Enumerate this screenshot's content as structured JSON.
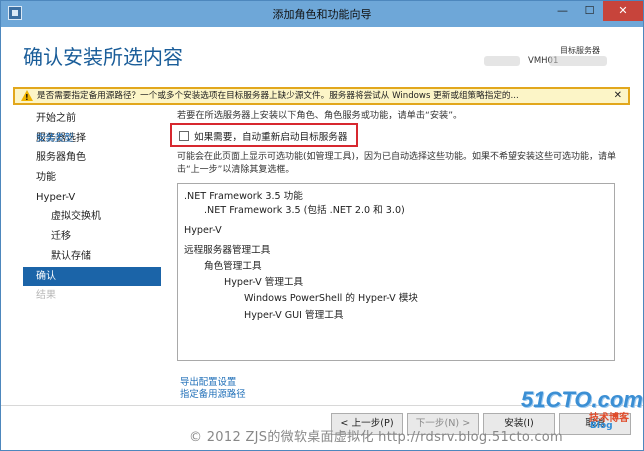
{
  "window": {
    "title": "添加角色和功能向导",
    "minimize": "—",
    "maximize": "☐",
    "close": "✕"
  },
  "header": {
    "page_title": "确认安装所选内容",
    "target_label": "目标服务器",
    "target_value": "VMH01"
  },
  "warning": {
    "icon": "warning-icon",
    "text": "是否需要指定备用源路径？一个或多个安装选项在目标服务器上缺少源文件。服务器将尝试从 Windows 更新或组策略指定的...",
    "close": "✕"
  },
  "sidebar": {
    "items": [
      {
        "label": "开始之前",
        "state": "normal"
      },
      {
        "label": "安装类型",
        "state": "link"
      },
      {
        "label": "服务器选择",
        "state": "normal"
      },
      {
        "label": "服务器角色",
        "state": "normal"
      },
      {
        "label": "功能",
        "state": "normal"
      },
      {
        "label": "Hyper-V",
        "state": "normal"
      },
      {
        "label": "虚拟交换机",
        "state": "normal"
      },
      {
        "label": "迁移",
        "state": "normal"
      },
      {
        "label": "默认存储",
        "state": "normal"
      },
      {
        "label": "确认",
        "state": "active"
      },
      {
        "label": "结果",
        "state": "disabled"
      }
    ]
  },
  "content": {
    "intro": "若要在所选服务器上安装以下角色、角色服务或功能，请单击“安装”。",
    "restart_checkbox": {
      "label": "如果需要，自动重新启动目标服务器",
      "checked": false
    },
    "note": "可能会在此页面上显示可选功能(如管理工具)，因为已自动选择这些功能。如果不希望安装这些可选功能，请单击“上一步”以清除其复选框。",
    "features": [
      ".NET Framework 3.5 功能",
      ".NET Framework 3.5 (包括 .NET 2.0 和 3.0)",
      "Hyper-V",
      "远程服务器管理工具",
      "角色管理工具",
      "Hyper-V 管理工具",
      "Windows PowerShell 的 Hyper-V 模块",
      "Hyper-V GUI 管理工具"
    ],
    "links": {
      "export": "导出配置设置",
      "alternate_source": "指定备用源路径"
    }
  },
  "buttons": {
    "prev": "< 上一步(P)",
    "next": "下一步(N) >",
    "install": "安装(I)",
    "cancel": "取消"
  },
  "overlay": {
    "watermark": "© 2012 ZJS的微软桌面虚拟化 http://rdsrv.blog.51cto.com",
    "logo_main": "51CTO.com",
    "logo_sub": "技术博客",
    "logo_blog": "Blog"
  }
}
